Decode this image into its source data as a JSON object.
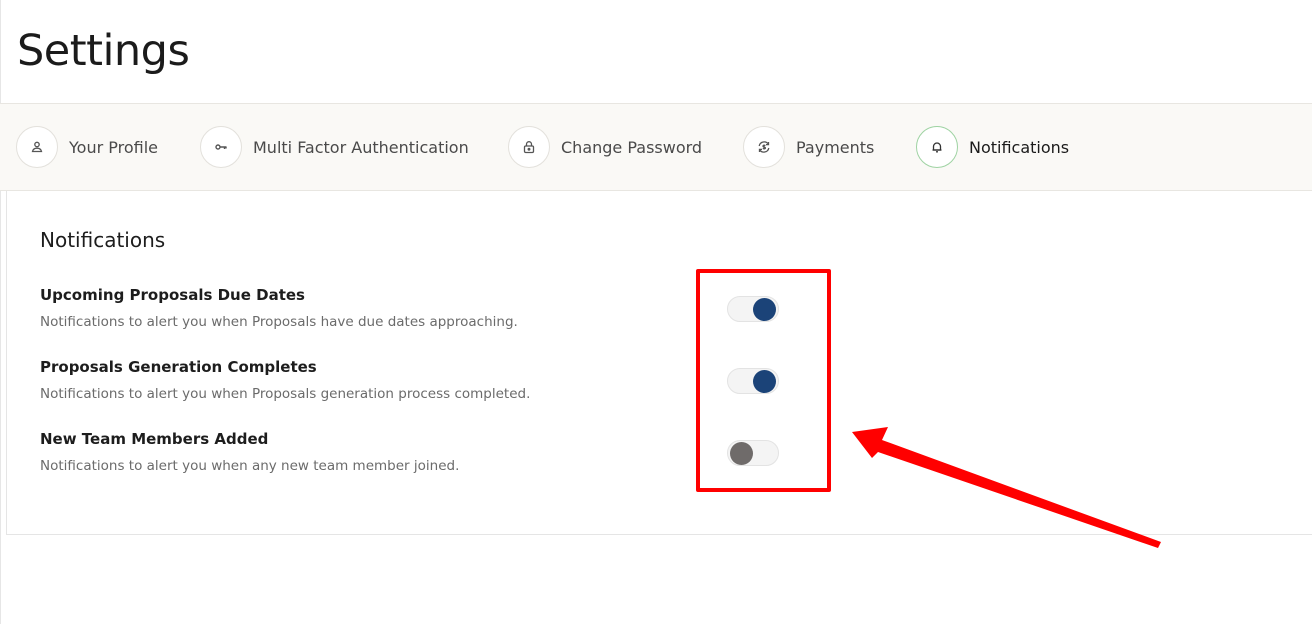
{
  "page": {
    "title": "Settings"
  },
  "tabs": [
    {
      "label": "Your Profile",
      "icon": "user-icon",
      "active": false
    },
    {
      "label": "Multi Factor Authentication",
      "icon": "key-icon",
      "active": false
    },
    {
      "label": "Change Password",
      "icon": "lock-icon",
      "active": false
    },
    {
      "label": "Payments",
      "icon": "refresh-currency-icon",
      "active": false
    },
    {
      "label": "Notifications",
      "icon": "bell-icon",
      "active": true
    }
  ],
  "notifications": {
    "title": "Notifications",
    "items": [
      {
        "title": "Upcoming Proposals Due Dates",
        "description": "Notifications to alert you when Proposals have due dates approaching.",
        "enabled": true
      },
      {
        "title": "Proposals Generation Completes",
        "description": "Notifications to alert you when Proposals generation process completed.",
        "enabled": true
      },
      {
        "title": "New Team Members Added",
        "description": "Notifications to alert you when any new team member joined.",
        "enabled": false
      }
    ]
  },
  "colors": {
    "toggle_on": "#1b4378",
    "toggle_off": "#6f6b6a",
    "active_tab_ring": "#9fd3a3",
    "annotation": "#ff0000",
    "tab_bar_bg": "#faf9f6"
  }
}
